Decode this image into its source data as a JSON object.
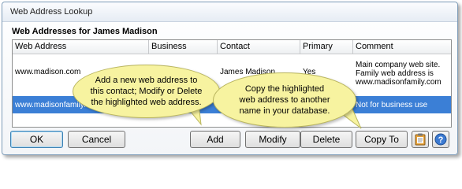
{
  "window": {
    "title": "Web Address Lookup"
  },
  "section_title": "Web Addresses for James Madison",
  "table": {
    "columns": [
      "Web Address",
      "Business",
      "Contact",
      "Primary",
      "Comment"
    ],
    "rows": [
      {
        "web_address": "www.madison.com",
        "business": "",
        "contact": "James Madison",
        "primary": "Yes",
        "comment_lines": [
          "Main company web site.",
          "Family web address is",
          "www.madisonfamily.com"
        ]
      },
      {
        "web_address": "www.madisonfamily.com",
        "business": "",
        "contact": "",
        "primary": "",
        "comment": "Not for business use",
        "selected": true
      }
    ]
  },
  "buttons": {
    "ok": "OK",
    "cancel": "Cancel",
    "add": "Add",
    "modify": "Modify",
    "delete": "Delete",
    "copy_to": "Copy To"
  },
  "icons": {
    "clipboard": "clipboard-icon",
    "help": "help-icon"
  },
  "callouts": {
    "add_modify_lines": [
      "Add a new web address to",
      "this contact; Modify or Delete",
      "the highlighted web address."
    ],
    "copy_lines": [
      "Copy the highlighted",
      "web address to another",
      "name in your database."
    ]
  },
  "colors": {
    "selection": "#3b7fd6",
    "callout": "#f7f3a0"
  }
}
